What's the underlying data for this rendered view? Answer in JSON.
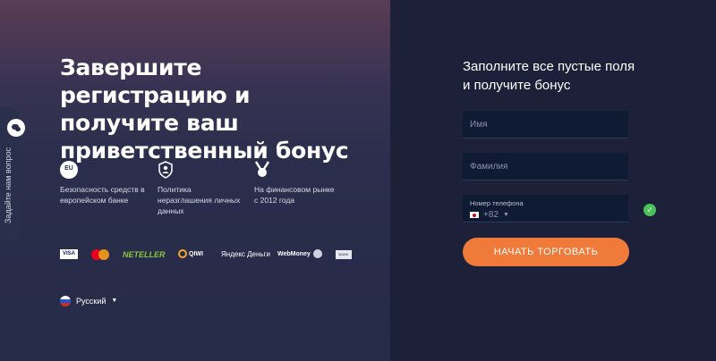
{
  "headline": "Завершите регистрацию и получите ваш приветственный бонус",
  "features": [
    {
      "icon": "eu-bank-icon",
      "icon_text": "EU",
      "icon_sub": "bank",
      "text": "Безопасность средств в европейском банке"
    },
    {
      "icon": "shield-person-icon",
      "text": "Политика неразглашения личных данных"
    },
    {
      "icon": "award-icon",
      "text": "На финансовом рынке с 2012 года"
    }
  ],
  "payments": {
    "visa": "VISA",
    "mastercard": "mastercard",
    "neteller": "NETELLER",
    "qiwi": "QIWI",
    "yandex": "Яндекс Деньги",
    "webmoney": "WebMoney",
    "bank": "BANK"
  },
  "language": {
    "current": "Русский"
  },
  "side_tab": {
    "label": "Задайте нам вопрос",
    "icon": "chat-icon"
  },
  "form": {
    "title": "Заполните все пустые поля и получите бонус",
    "name_placeholder": "Имя",
    "surname_placeholder": "Фамилия",
    "phone_label": "Номер телефона",
    "phone_code": "+82",
    "submit": "НАЧАТЬ ТОРГОВАТЬ"
  },
  "colors": {
    "accent": "#f07a3a",
    "valid": "#4cc15a"
  }
}
